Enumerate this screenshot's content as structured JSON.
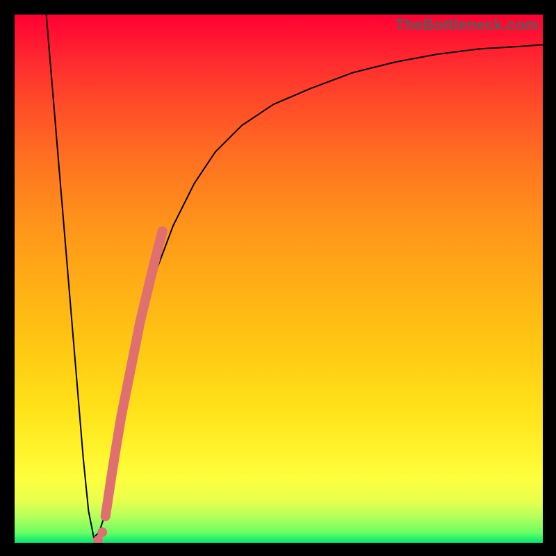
{
  "watermark": "TheBottleneck.com",
  "chart_data": {
    "type": "line",
    "title": "",
    "xlabel": "",
    "ylabel": "",
    "xlim": [
      0,
      100
    ],
    "ylim": [
      0,
      100
    ],
    "grid": false,
    "legend": false,
    "series": [
      {
        "name": "bottleneck-curve",
        "color": "#000000",
        "x": [
          6,
          7,
          8,
          9,
          10,
          11,
          12,
          13,
          14,
          15,
          16,
          17,
          18,
          19,
          20,
          21,
          23,
          25,
          27,
          30,
          34,
          38,
          43,
          49,
          56,
          64,
          72,
          80,
          88,
          96,
          100
        ],
        "y": [
          100,
          88,
          76,
          64,
          52,
          40,
          28,
          16,
          6,
          1,
          2,
          5,
          9,
          14,
          20,
          26,
          36,
          44,
          52,
          60,
          68,
          74,
          79,
          83,
          86,
          89,
          91,
          92.5,
          93.5,
          94,
          94.3
        ]
      }
    ],
    "highlight_segment": {
      "name": "marker-band",
      "color": "#e07070",
      "x": [
        17.2,
        17.8,
        18.4,
        19.2,
        20.2,
        21.4,
        22.6,
        23.8,
        25.0,
        26.2,
        27.2,
        28.0
      ],
      "y": [
        5,
        9,
        13,
        18,
        24,
        30,
        36,
        42,
        47,
        52,
        56,
        59
      ]
    },
    "highlight_dots": {
      "name": "marker-dots",
      "color": "#e07070",
      "x": [
        15.8,
        16.6
      ],
      "y": [
        0.5,
        2
      ]
    },
    "gradient_stops": [
      {
        "pos": 0.0,
        "color": "#ff0033"
      },
      {
        "pos": 0.4,
        "color": "#ff951a"
      },
      {
        "pos": 0.82,
        "color": "#fff22a"
      },
      {
        "pos": 1.0,
        "color": "#00e874"
      }
    ]
  }
}
